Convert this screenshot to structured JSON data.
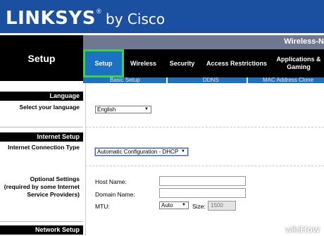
{
  "brand": {
    "logo_main": "LINKSYS",
    "logo_mark": "®",
    "logo_sub": "by Cisco"
  },
  "header": {
    "section_title": "Setup",
    "product": "Wireless-N"
  },
  "tabs": [
    {
      "label": "Setup",
      "active": true
    },
    {
      "label": "Wireless"
    },
    {
      "label": "Security"
    },
    {
      "label": "Access Restrictions"
    },
    {
      "label": "Applications & Gaming"
    }
  ],
  "subtabs": [
    "Basic Setup",
    "DDNS",
    "MAC Address Clone"
  ],
  "sections": {
    "language": {
      "header": "Language",
      "label": "Select your language",
      "value": "English"
    },
    "internet": {
      "header": "Internet Setup",
      "type_label": "Internet Connection Type",
      "type_value": "Automatic Configuration - DHCP",
      "optional_label_1": "Optional Settings",
      "optional_label_2": "(required by some Internet",
      "optional_label_3": "Service Providers)",
      "host_name_label": "Host Name:",
      "host_name_value": "",
      "domain_name_label": "Domain Name:",
      "domain_name_value": "",
      "mtu_label": "MTU:",
      "mtu_value": "Auto",
      "size_label": "Size:",
      "size_value": "1500"
    },
    "network": {
      "header": "Network Setup"
    }
  },
  "watermark": {
    "prefix": "wiki",
    "suffix": "How"
  },
  "colors": {
    "brand_blue": "#1b4fa0",
    "tab_active": "#1d71c2",
    "highlight": "#3fd13f"
  }
}
